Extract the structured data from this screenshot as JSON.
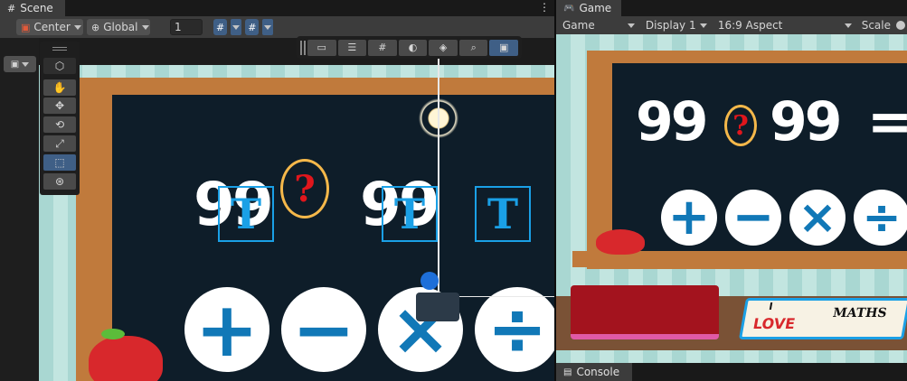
{
  "scene": {
    "tab_label": "Scene",
    "pivot_label": "Center",
    "space_label": "Global",
    "grid_value": "1",
    "overlay_tools": [
      "rect-transform-icon",
      "align-icon",
      "grid-snap-icon",
      "lighting-icon",
      "gizmos-icon",
      "search-icon",
      "camera-toggle-icon"
    ],
    "view_tools": [
      "cube-icon",
      "hand-icon",
      "move-icon",
      "rotate-icon",
      "scale-icon",
      "rect-icon",
      "transform-icon"
    ],
    "content": {
      "number_left": "99",
      "number_right": "99",
      "question": "?",
      "t_glyph": "T",
      "operators": [
        "+",
        "−",
        "×",
        "÷"
      ]
    }
  },
  "game": {
    "tab_label": "Game",
    "game_dropdown": "Game",
    "display_dropdown": "Display 1",
    "aspect_dropdown": "16:9 Aspect",
    "scale_label": "Scale",
    "content": {
      "number_left": "99",
      "number_right": "99",
      "question": "?",
      "equals": "=",
      "operators": [
        "+",
        "−",
        "×",
        "÷"
      ],
      "book_line1": "I",
      "book_line2": "LOVE",
      "book_line3": "MATHS"
    }
  },
  "console": {
    "tab_label": "Console"
  },
  "colors": {
    "board_frame": "#c07a3c",
    "board_inner": "#0e1d29",
    "operator_blue": "#1178b7",
    "accent_blue": "#3f5f86"
  }
}
